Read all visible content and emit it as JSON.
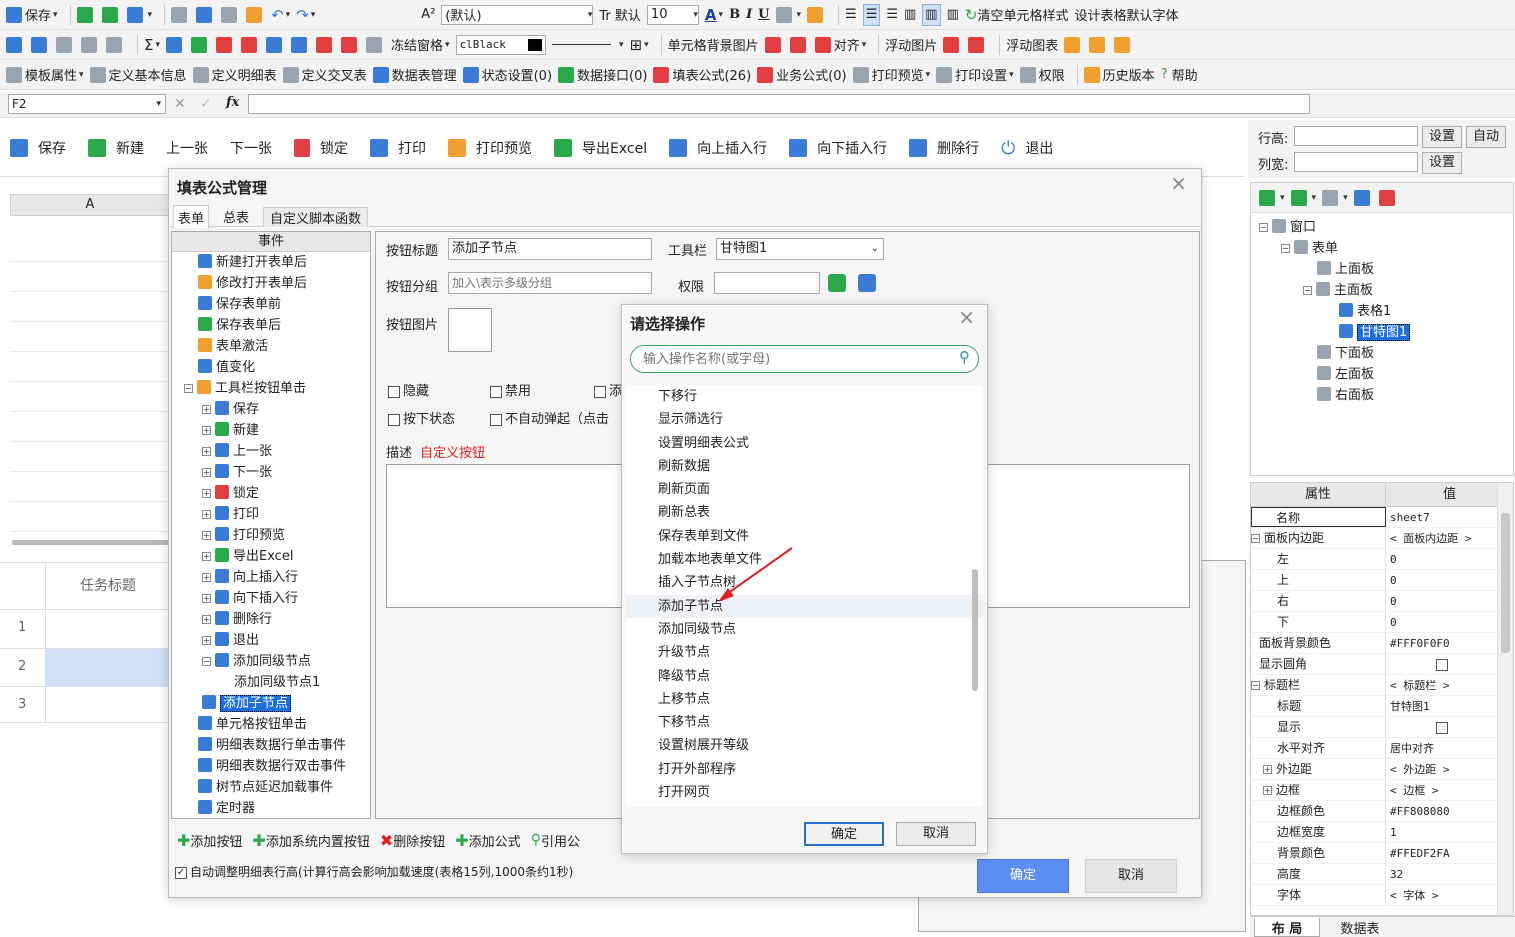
{
  "toolbar1": {
    "save": "保存",
    "font_prefix": "A²",
    "font": "(默认)",
    "size_prefix": "Tr 默认",
    "size": "10",
    "bold": "B",
    "italic": "I",
    "underline": "U",
    "clear_style": "清空单元格样式",
    "default_font": "设计表格默认字体"
  },
  "toolbar2": {
    "freeze": "冻结窗格",
    "color": "clBlack",
    "cell_bg": "单元格背景图片",
    "align": "对齐",
    "float_image": "浮动图片",
    "float_chart": "浮动图表"
  },
  "toolbar3": {
    "items": [
      "模板属性",
      "定义基本信息",
      "定义明细表",
      "定义交叉表",
      "数据表管理",
      "状态设置(0)",
      "数据接口(0)",
      "填表公式(26)",
      "业务公式(0)",
      "打印预览",
      "打印设置",
      "权限",
      "历史版本",
      "帮助"
    ]
  },
  "formula_bar": {
    "cell": "F2",
    "fx": "fx",
    "value": ""
  },
  "action_bar": {
    "items": [
      "保存",
      "新建",
      "上一张",
      "下一张",
      "锁定",
      "打印",
      "打印预览",
      "导出Excel",
      "向上插入行",
      "向下插入行",
      "删除行",
      "退出"
    ]
  },
  "right_top": {
    "row_height": "行高:",
    "col_width": "列宽:",
    "set": "设置",
    "auto": "自动"
  },
  "layout_tree": {
    "items": [
      "窗口",
      "表单",
      "上面板",
      "主面板",
      "表格1",
      "甘特图1",
      "下面板",
      "左面板",
      "右面板"
    ]
  },
  "props": {
    "header_k": "属性",
    "header_v": "值",
    "rows": [
      [
        "名称",
        "sheet7"
      ],
      [
        "面板内边距",
        "< 面板内边距 >"
      ],
      [
        "左",
        "0"
      ],
      [
        "上",
        "0"
      ],
      [
        "右",
        "0"
      ],
      [
        "下",
        "0"
      ],
      [
        "面板背景颜色",
        "#FFF0F0F0"
      ],
      [
        "显示圆角",
        ""
      ],
      [
        "标题栏",
        "< 标题栏 >"
      ],
      [
        "标题",
        "甘特图1"
      ],
      [
        "显示",
        ""
      ],
      [
        "水平对齐",
        "居中对齐"
      ],
      [
        "外边距",
        "< 外边距 >"
      ],
      [
        "边框",
        "< 边框 >"
      ],
      [
        "边框颜色",
        "#FF808080"
      ],
      [
        "边框宽度",
        "1"
      ],
      [
        "背景颜色",
        "#FFEDF2FA"
      ],
      [
        "高度",
        "32"
      ],
      [
        "字体",
        "< 字体 >"
      ]
    ],
    "tabs": [
      "布 局",
      "数据表"
    ]
  },
  "sheet": {
    "col_a": "A",
    "task_title": "任务标题",
    "rows": [
      "1",
      "2",
      "3"
    ]
  },
  "formula_dialog": {
    "title": "填表公式管理",
    "tabs": [
      "表单",
      "总表",
      "自定义脚本函数"
    ],
    "tree_header": "事件",
    "tree": [
      "新建打开表单后",
      "修改打开表单后",
      "保存表单前",
      "保存表单后",
      "表单激活",
      "值变化",
      "工具栏按钮单击",
      "保存",
      "新建",
      "上一张",
      "下一张",
      "锁定",
      "打印",
      "打印预览",
      "导出Excel",
      "向上插入行",
      "向下插入行",
      "删除行",
      "退出",
      "添加同级节点",
      "添加同级节点1",
      "添加子节点",
      "单元格按钮单击",
      "明细表数据行单击事件",
      "明细表数据行双击事件",
      "树节点延迟加载事件",
      "定时器"
    ],
    "btn_title_label": "按钮标题",
    "btn_title_value": "添加子节点",
    "toolbar_label": "工具栏",
    "toolbar_value": "甘特图1",
    "group_label": "按钮分组",
    "group_placeholder": "加入\\表示多级分组",
    "perm_label": "权限",
    "image_label": "按钮图片",
    "chk_hide": "隐藏",
    "chk_disable": "禁用",
    "chk_add": "添",
    "chk_pressed": "按下状态",
    "chk_noauto": "不自动弹起（点击",
    "desc_label": "描述",
    "desc_value": "自定义按钮",
    "bottom_btns": [
      "添加按钮",
      "添加系统内置按钮",
      "删除按钮",
      "添加公式",
      "引用公"
    ],
    "auto_adjust": "自动调整明细表行高(计算行高会影响加载速度(表格15列,1000条约1秒)",
    "ok": "确定",
    "cancel": "取消"
  },
  "op_dialog": {
    "title": "请选择操作",
    "search_placeholder": "输入操作名称(或字母)",
    "items": [
      "下移行",
      "显示筛选行",
      "设置明细表公式",
      "刷新数据",
      "刷新页面",
      "刷新总表",
      "保存表单到文件",
      "加载本地表单文件",
      "插入子节点树",
      "添加子节点",
      "添加同级节点",
      "升级节点",
      "降级节点",
      "上移节点",
      "下移节点",
      "设置树展开等级",
      "打开外部程序",
      "打开网页"
    ],
    "selected": "添加子节点",
    "ok": "确定",
    "cancel": "取消"
  }
}
